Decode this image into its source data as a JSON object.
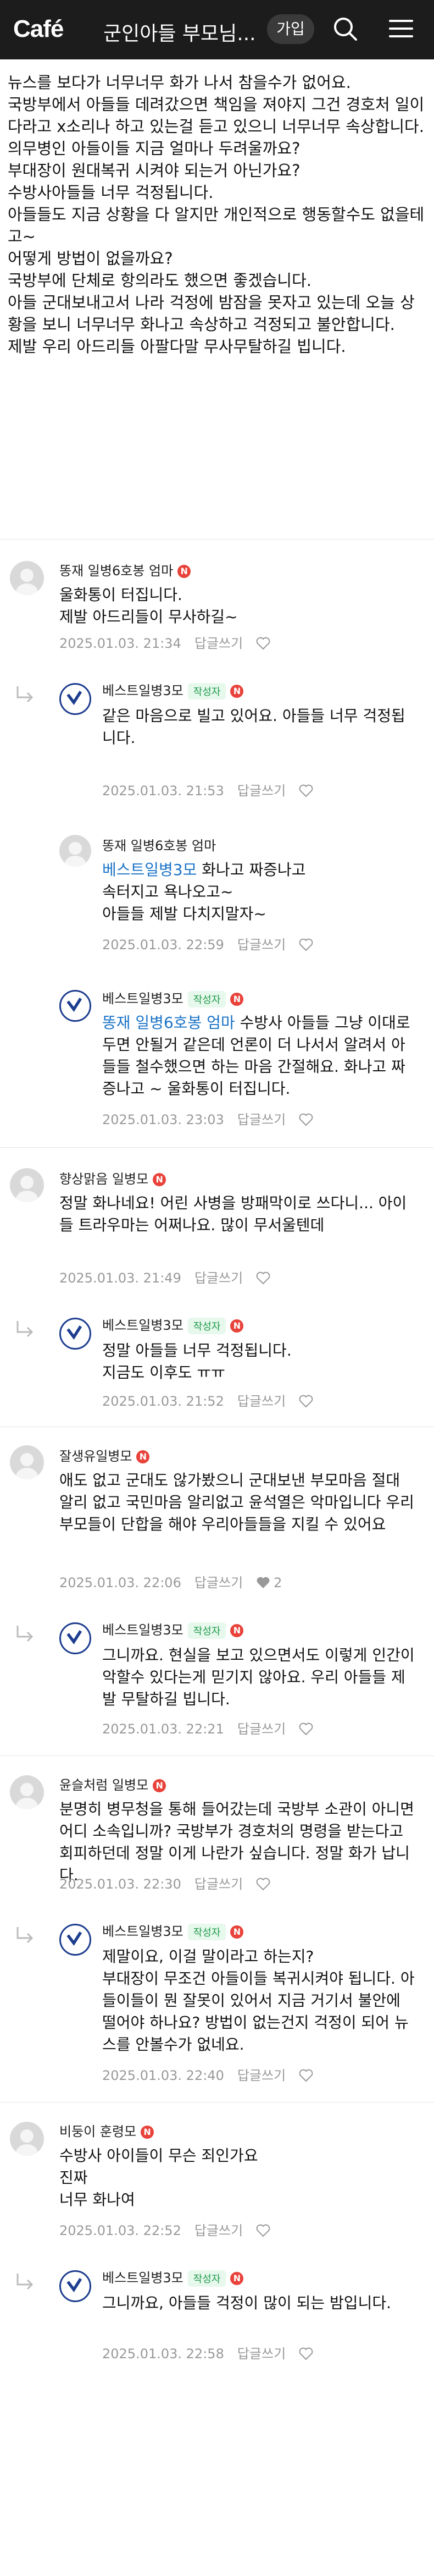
{
  "header": {
    "logo": "Café",
    "cafe_title": "군인아들 부모님...",
    "join_label": "가입",
    "search_icon": "search-icon",
    "menu_icon": "menu-icon"
  },
  "post": {
    "lines": [
      "뉴스를 보다가 너무너무 화가 나서 참을수가 없어요.",
      "국방부에서 아들들 데려갔으면 책임을 져야지 그건 경호처 일이다라고 x소리나 하고 있는걸 듣고 있으니 너무너무 속상합니다.",
      "의무병인  아들이들 지금 얼마나 두려울까요?",
      "부대장이 원대복귀 시켜야 되는거 아닌가요?",
      "수방사아들들 너무 걱정됩니다.",
      "아들들도 지금 상황을 다 알지만 개인적으로 행동할수도 없을테고~",
      "어떻게 방법이 없을까요?",
      "국방부에 단체로 항의라도 했으면 좋겠습니다.",
      "아들 군대보내고서 나라 걱정에 밤잠을 못자고 있는데 오늘 상황을 보니 너무너무 화나고 속상하고 걱정되고 불안합니다.",
      "제발 우리 아드리들 아팔다말 무사무탈하길 빕니다."
    ]
  },
  "comments": [
    {
      "nick": "똥재 일병6호봉 엄마",
      "badge": "N",
      "lines": [
        "울화통이 터집니다.",
        "제발 아드리들이 무사하길~"
      ],
      "date": "2025.01.03. 21:34",
      "reply_label": "답글쓰기"
    },
    {
      "nick": "베스트일병3모",
      "badge": "N",
      "writer": "작성자",
      "lines": [
        "같은 마음으로 빌고 있어요. 아들들 너무 걱정됩니다."
      ],
      "date": "2025.01.03. 21:53",
      "reply_label": "답글쓰기"
    },
    {
      "nick": "똥재 일병6호봉 엄마",
      "mention": "베스트일병3모",
      "lines": [
        "화나고 짜증나고",
        "속터지고 욕나오고~",
        "아들들 제발 다치지말자~"
      ],
      "date": "2025.01.03. 22:59",
      "reply_label": "답글쓰기"
    },
    {
      "nick": "베스트일병3모",
      "badge": "N",
      "writer": "작성자",
      "mention": "똥재 일병6호봉 엄마",
      "lines": [
        "수방사 아들들 그냥 이대로 두면 안될거 같은데 언론이 더 나서서 알려서 아들들 철수했으면 하는 마음 간절해요. 화나고 짜증나고 ~ 울화통이 터집니다."
      ],
      "date": "2025.01.03. 23:03",
      "reply_label": "답글쓰기"
    },
    {
      "nick": "향상맑음 일병모",
      "badge": "N",
      "lines": [
        "정말 화나네요! 어린 사병을 방패막이로 쓰다니... 아이들 트라우마는 어쩌나요. 많이 무서울텐데"
      ],
      "date": "2025.01.03. 21:49",
      "reply_label": "답글쓰기"
    },
    {
      "nick": "베스트일병3모",
      "badge": "N",
      "writer": "작성자",
      "lines": [
        "정말 아들들 너무 걱정됩니다.",
        "지금도 이후도 ㅠㅠ"
      ],
      "date": "2025.01.03. 21:52",
      "reply_label": "답글쓰기"
    },
    {
      "nick": "잘생유일병모",
      "badge": "N",
      "lines": [
        "애도 없고 군대도 않가봤으니 군대보낸 부모마음 절대 알리 없고 국민마음 알리없고 윤석열은 악마입니다 우리 부모들이 단합을 해야 우리아들들을 지킬 수 있어요"
      ],
      "date": "2025.01.03. 22:06",
      "reply_label": "답글쓰기",
      "reply_count": "2"
    },
    {
      "nick": "베스트일병3모",
      "badge": "N",
      "writer": "작성자",
      "lines": [
        "그니까요. 현실을 보고 있으면서도 이렇게 인간이 악할수 있다는게 믿기지 않아요. 우리 아들들 제발 무탈하길 빕니다."
      ],
      "date": "2025.01.03. 22:21",
      "reply_label": "답글쓰기"
    },
    {
      "nick": "윤슬처럼 일병모",
      "badge": "N",
      "lines": [
        "분명히 병무청을 통해 들어갔는데 국방부 소관이 아니면 어디 소속입니까? 국방부가 경호처의 명령을 받는다고 회피하던데 정말 이게 나란가 싶습니다. 정말 화가 납니다."
      ],
      "date": "2025.01.03. 22:30",
      "reply_label": "답글쓰기"
    },
    {
      "nick": "베스트일병3모",
      "badge": "N",
      "writer": "작성자",
      "lines": [
        "제말이요, 이걸 말이라고 하는지?",
        "부대장이 무조건 아들이들 복귀시켜야 됩니다. 아들이들이 뭔 잘못이 있어서 지금 거기서 불안에 떨어야 하나요? 방법이 없는건지 걱정이 되어 뉴스를 안볼수가 없네요."
      ],
      "date": "2025.01.03. 22:40",
      "reply_label": "답글쓰기"
    },
    {
      "nick": "비둥이 훈령모",
      "badge": "N",
      "lines": [
        "수방사 아이들이 무슨 죄인가요",
        "진짜",
        "너무 화나여"
      ],
      "date": "2025.01.03. 22:52",
      "reply_label": "답글쓰기"
    },
    {
      "nick": "베스트일병3모",
      "badge": "N",
      "writer": "작성자",
      "lines": [
        "그니까요, 아들들 걱정이 많이 되는 밤입니다."
      ],
      "date": "2025.01.03. 22:58",
      "reply_label": "답글쓰기"
    }
  ]
}
